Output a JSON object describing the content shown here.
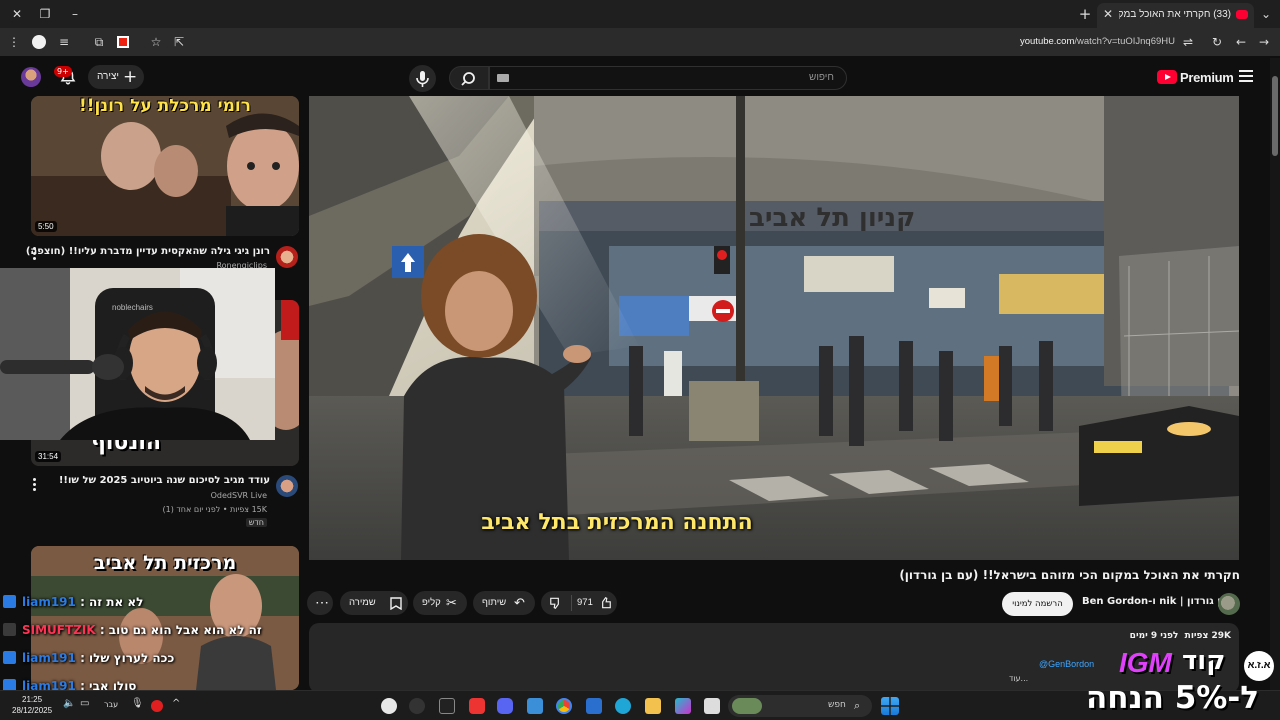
{
  "browser": {
    "tab_title": "(33) חקרתי את האוכל במקום ה",
    "url_domain": "youtube.com",
    "url_path": "/watch?v=tuOIJnq69HU"
  },
  "youtube": {
    "logo_text": "Premium",
    "search_placeholder": "חיפוש",
    "create_label": "יצירה",
    "notification_count": "9+"
  },
  "video": {
    "subtitle": "התחנה המרכזית בתל אביב",
    "title": "חקרתי את האוכל במקום הכי מזוהם בישראל!! (עם בן גורדון)",
    "channel_name": "Ben Gordon-ו nik | בן גורדון",
    "subscribe_label": "הרשמה למינוי",
    "like_count": "971",
    "share_label": "שיתוף",
    "clip_label": "קליפ",
    "save_label": "שמירה",
    "views": "29K צפיות",
    "date": "לפני 9 ימים",
    "desc_handle": "@GenBordon",
    "desc_line": "...עוד"
  },
  "related": [
    {
      "thumb_text": "רומי מרכלת על רונן!!",
      "duration": "5:50",
      "title": "רונן גיגי גילה שהאקסית עדיין מדברת עליו!! (חוצפה)",
      "channel": "Ronengiclips"
    },
    {
      "thumb_text": "הונסוף",
      "duration": "31:54",
      "title": "עודד מגיב לסיכום שנה ביוטיוב 2025 של שו!!",
      "channel": "OdedSVR Live",
      "meta": "15K צפיות • לפני יום אחד (1)",
      "badge": "חדש"
    },
    {
      "thumb_text": "מרכזית תל אביב"
    }
  ],
  "webcam": {
    "chair_brand": "noblechairs"
  },
  "chat": [
    {
      "user": "liam191",
      "text": "לא את זה",
      "color": "#2a7be4"
    },
    {
      "user": "SIMUFTZIK",
      "text": "זה לא הוא אבל הוא גם טוב",
      "color": "#ff3355"
    },
    {
      "user": "liam191",
      "text": "ככה לערוץ שלו",
      "color": "#2a7be4"
    },
    {
      "user": "liam191",
      "text": "סולו אבי",
      "color": "#2a7be4"
    }
  ],
  "taskbar": {
    "time": "21:25",
    "date": "28/12/2025",
    "lang": "עבר",
    "search_label": "חפש"
  },
  "promo": {
    "line1": "קוד",
    "brand": "IGM",
    "line2": "ל-5% הנחה",
    "logo": "א.ז.א"
  },
  "colors": {
    "accent_red": "#ff0033",
    "subtitle_yellow": "#ffe76a",
    "promo_purple": "#e040fb"
  }
}
